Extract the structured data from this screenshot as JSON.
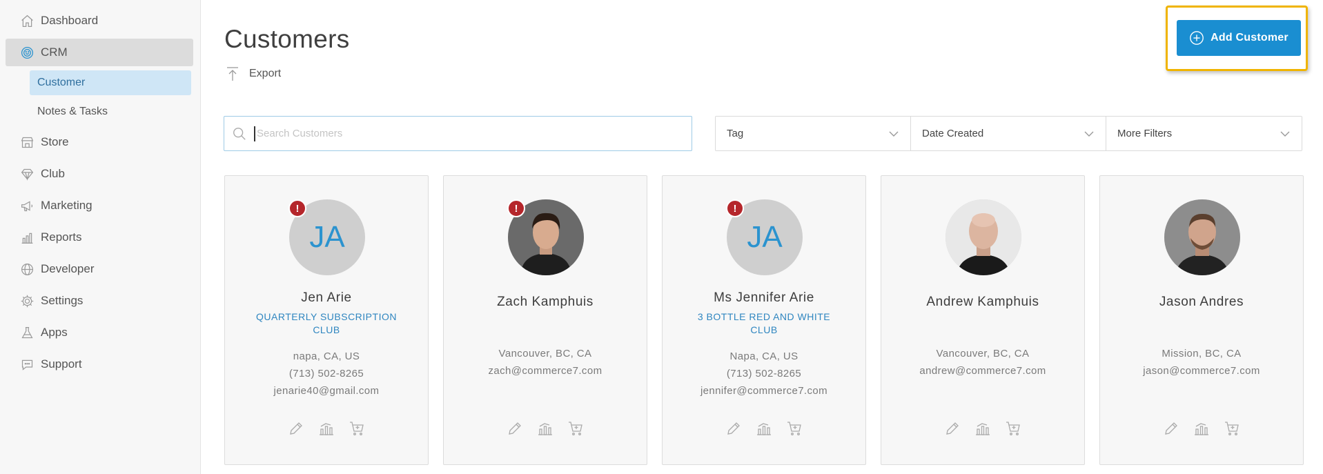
{
  "sidebar": {
    "items": [
      {
        "label": "Dashboard",
        "icon": "home-icon"
      },
      {
        "label": "CRM",
        "icon": "smiley-icon"
      },
      {
        "label": "Store",
        "icon": "store-icon"
      },
      {
        "label": "Club",
        "icon": "diamond-icon"
      },
      {
        "label": "Marketing",
        "icon": "megaphone-icon"
      },
      {
        "label": "Reports",
        "icon": "bar-chart-icon"
      },
      {
        "label": "Developer",
        "icon": "globe-icon"
      },
      {
        "label": "Settings",
        "icon": "gear-icon"
      },
      {
        "label": "Apps",
        "icon": "flask-icon"
      },
      {
        "label": "Support",
        "icon": "chat-icon"
      }
    ],
    "crm_sub": [
      {
        "label": "Customer"
      },
      {
        "label": "Notes & Tasks"
      }
    ]
  },
  "header": {
    "title": "Customers",
    "export_label": "Export",
    "add_label": "Add Customer"
  },
  "search": {
    "placeholder": "Search Customers",
    "value": ""
  },
  "filters": [
    {
      "label": "Tag"
    },
    {
      "label": "Date Created"
    },
    {
      "label": "More Filters"
    }
  ],
  "colors": {
    "accent": "#1a8ed1",
    "highlight": "#f0b400",
    "alert": "#b5262b",
    "club": "#2f86c0"
  },
  "customers": [
    {
      "initials": "JA",
      "alert": "!",
      "name": "Jen Arie",
      "club": "QUARTERLY SUBSCRIPTION CLUB",
      "location": "napa, CA, US",
      "phone": "(713) 502-8265",
      "email": "jenarie40@gmail.com"
    },
    {
      "initials": "",
      "alert": "!",
      "name": "Zach Kamphuis",
      "club": "",
      "location": "Vancouver, BC, CA",
      "phone": "",
      "email": "zach@commerce7.com"
    },
    {
      "initials": "JA",
      "alert": "!",
      "name": "Ms Jennifer Arie",
      "club": "3 BOTTLE RED AND WHITE CLUB",
      "location": "Napa, CA, US",
      "phone": "(713) 502-8265",
      "email": "jennifer@commerce7.com"
    },
    {
      "initials": "",
      "alert": "",
      "name": "Andrew Kamphuis",
      "club": "",
      "location": "Vancouver, BC, CA",
      "phone": "",
      "email": "andrew@commerce7.com"
    },
    {
      "initials": "",
      "alert": "",
      "name": "Jason Andres",
      "club": "",
      "location": "Mission, BC, CA",
      "phone": "",
      "email": "jason@commerce7.com"
    }
  ]
}
